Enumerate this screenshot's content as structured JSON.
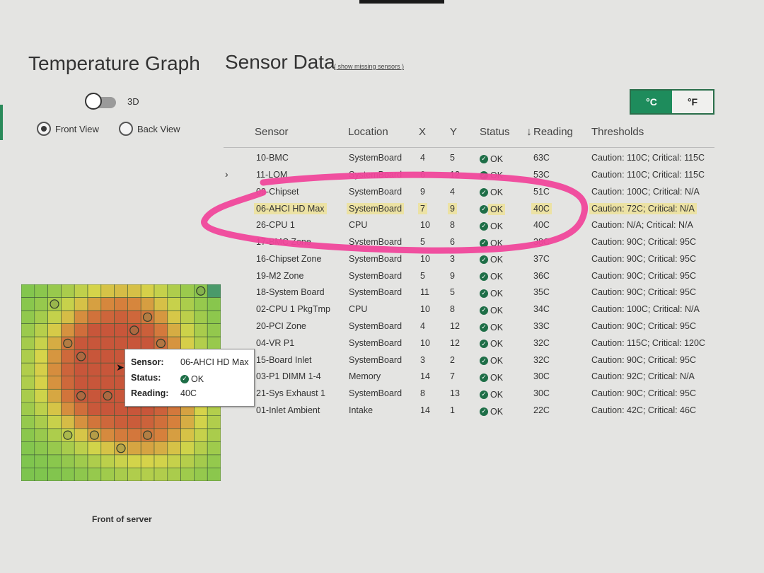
{
  "left_panel": {
    "title": "Temperature Graph",
    "toggle_3d_label": "3D",
    "toggle_3d_on": false,
    "views": [
      {
        "label": "Front View",
        "checked": true
      },
      {
        "label": "Back View",
        "checked": false
      }
    ],
    "footer_label": "Front of server",
    "tooltip": {
      "sensor_key": "Sensor:",
      "sensor_value": "06-AHCI HD Max",
      "status_key": "Status:",
      "status_value": "OK",
      "reading_key": "Reading:",
      "reading_value": "40C"
    }
  },
  "sensor_panel": {
    "title": "Sensor Data",
    "missing_link": "( show missing sensors )",
    "units": {
      "celsius": "°C",
      "fahrenheit": "°F",
      "active": "celsius"
    },
    "columns": {
      "sensor": "Sensor",
      "location": "Location",
      "x": "X",
      "y": "Y",
      "status": "Status",
      "reading": "Reading",
      "thresholds": "Thresholds"
    },
    "sort_icon": "arrow-down-icon",
    "rows": [
      {
        "sensor": "10-BMC",
        "location": "SystemBoard",
        "x": "4",
        "y": "5",
        "status": "OK",
        "reading": "63C",
        "thresholds": "Caution: 110C; Critical: 115C"
      },
      {
        "sensor": "11-LOM",
        "location": "SystemBoard",
        "x": "6",
        "y": "12",
        "status": "OK",
        "reading": "53C",
        "thresholds": "Caution: 110C; Critical: 115C"
      },
      {
        "sensor": "09-Chipset",
        "location": "SystemBoard",
        "x": "9",
        "y": "4",
        "status": "OK",
        "reading": "51C",
        "thresholds": "Caution: 100C; Critical: N/A"
      },
      {
        "sensor": "06-AHCI HD Max",
        "location": "SystemBoard",
        "x": "7",
        "y": "9",
        "status": "OK",
        "reading": "40C",
        "thresholds": "Caution: 72C; Critical: N/A",
        "highlighted": true
      },
      {
        "sensor": "26-CPU 1",
        "location": "CPU",
        "x": "10",
        "y": "8",
        "status": "OK",
        "reading": "40C",
        "thresholds": "Caution: N/A; Critical: N/A"
      },
      {
        "sensor": "17-BMC Zone",
        "location": "SystemBoard",
        "x": "5",
        "y": "6",
        "status": "OK",
        "reading": "38C",
        "thresholds": "Caution: 90C; Critical: 95C"
      },
      {
        "sensor": "16-Chipset Zone",
        "location": "SystemBoard",
        "x": "10",
        "y": "3",
        "status": "OK",
        "reading": "37C",
        "thresholds": "Caution: 90C; Critical: 95C"
      },
      {
        "sensor": "19-M2 Zone",
        "location": "SystemBoard",
        "x": "5",
        "y": "9",
        "status": "OK",
        "reading": "36C",
        "thresholds": "Caution: 90C; Critical: 95C"
      },
      {
        "sensor": "18-System Board",
        "location": "SystemBoard",
        "x": "11",
        "y": "5",
        "status": "OK",
        "reading": "35C",
        "thresholds": "Caution: 90C; Critical: 95C"
      },
      {
        "sensor": "02-CPU 1 PkgTmp",
        "location": "CPU",
        "x": "10",
        "y": "8",
        "status": "OK",
        "reading": "34C",
        "thresholds": "Caution: 100C; Critical: N/A"
      },
      {
        "sensor": "20-PCI Zone",
        "location": "SystemBoard",
        "x": "4",
        "y": "12",
        "status": "OK",
        "reading": "33C",
        "thresholds": "Caution: 90C; Critical: 95C"
      },
      {
        "sensor": "04-VR P1",
        "location": "SystemBoard",
        "x": "10",
        "y": "12",
        "status": "OK",
        "reading": "32C",
        "thresholds": "Caution: 115C; Critical: 120C"
      },
      {
        "sensor": "15-Board Inlet",
        "location": "SystemBoard",
        "x": "3",
        "y": "2",
        "status": "OK",
        "reading": "32C",
        "thresholds": "Caution: 90C; Critical: 95C"
      },
      {
        "sensor": "03-P1 DIMM 1-4",
        "location": "Memory",
        "x": "14",
        "y": "7",
        "status": "OK",
        "reading": "30C",
        "thresholds": "Caution: 92C; Critical: N/A"
      },
      {
        "sensor": "21-Sys Exhaust 1",
        "location": "SystemBoard",
        "x": "8",
        "y": "13",
        "status": "OK",
        "reading": "30C",
        "thresholds": "Caution: 90C; Critical: 95C"
      },
      {
        "sensor": "01-Inlet Ambient",
        "location": "Intake",
        "x": "14",
        "y": "1",
        "status": "OK",
        "reading": "22C",
        "thresholds": "Caution: 42C; Critical: 46C"
      }
    ]
  },
  "colors": {
    "accent_green": "#1e8c5c",
    "highlight": "#ece2a4",
    "marker_pink": "#f0479b",
    "ok_icon": "#1e6e47"
  }
}
